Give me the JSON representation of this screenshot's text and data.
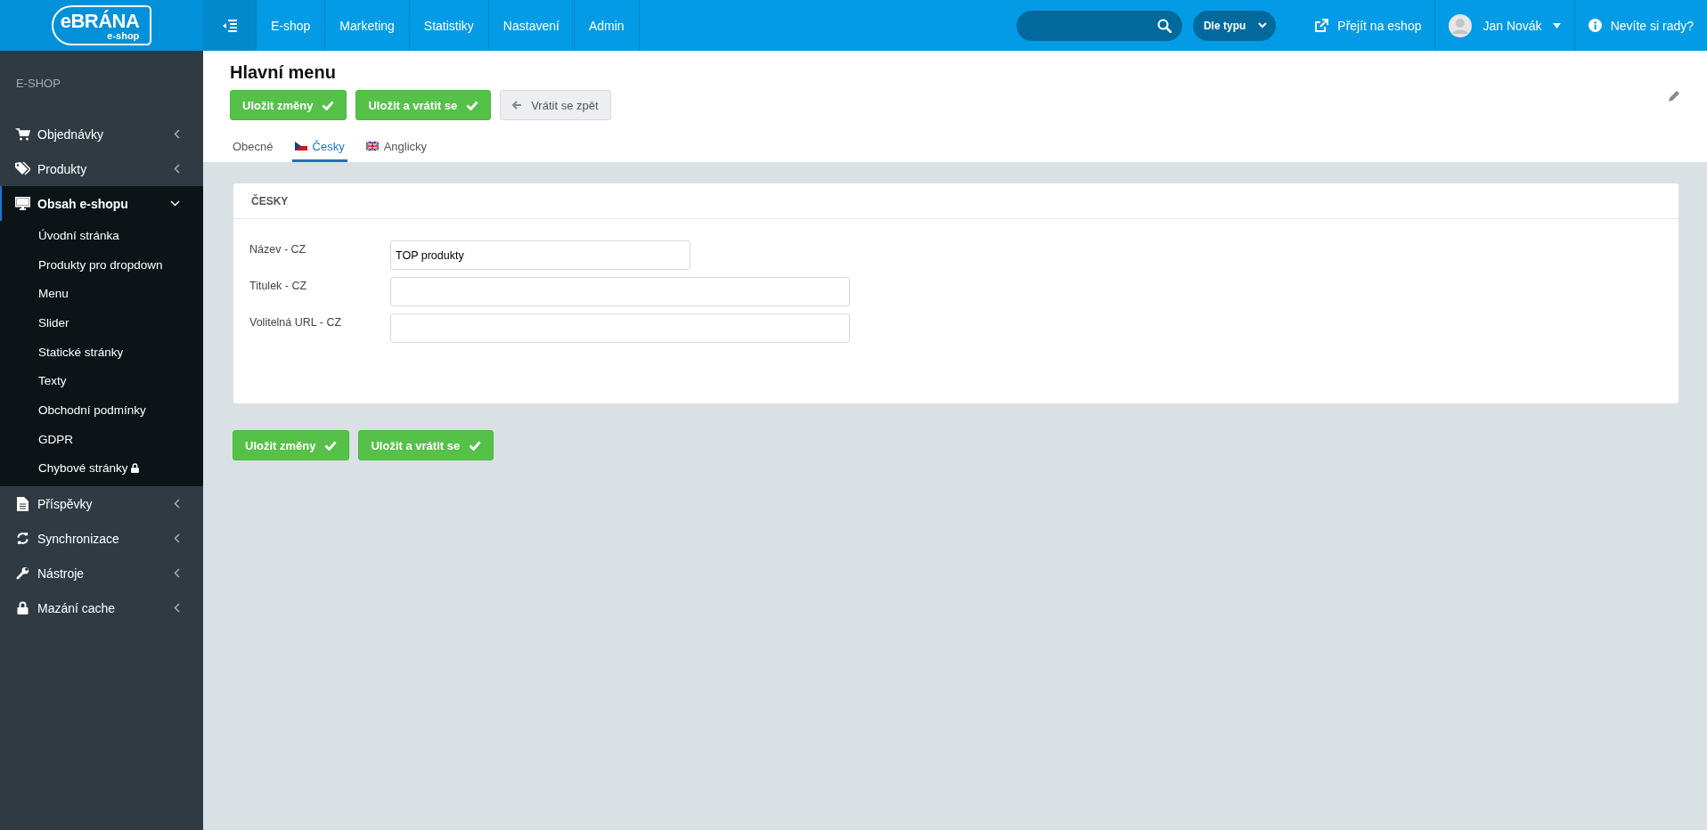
{
  "logo": {
    "name": "eBRÁNA",
    "sub": "e-shop"
  },
  "top_nav": [
    {
      "label": "E-shop"
    },
    {
      "label": "Marketing"
    },
    {
      "label": "Statistiky"
    },
    {
      "label": "Nastavení"
    },
    {
      "label": "Admin"
    }
  ],
  "search": {
    "filter": "Dle typu"
  },
  "eshop_link": "Přejít na eshop",
  "user": "Jan Novák",
  "help": "Nevíte si rady?",
  "sidebar": {
    "heading": "E-SHOP",
    "items": [
      {
        "label": "Objednávky",
        "expanded": false,
        "selected": false
      },
      {
        "label": "Produkty",
        "expanded": false,
        "selected": false
      },
      {
        "label": "Obsah e-shopu",
        "expanded": true,
        "selected": true,
        "children": [
          {
            "label": "Úvodní stránka",
            "locked": false
          },
          {
            "label": "Produkty pro dropdown",
            "locked": false
          },
          {
            "label": "Menu",
            "locked": false
          },
          {
            "label": "Slider",
            "locked": false
          },
          {
            "label": "Statické stránky",
            "locked": false
          },
          {
            "label": "Texty",
            "locked": false
          },
          {
            "label": "Obchodní podmínky",
            "locked": false
          },
          {
            "label": "GDPR",
            "locked": false
          },
          {
            "label": "Chybové stránky",
            "locked": true
          }
        ]
      },
      {
        "label": "Příspěvky",
        "expanded": false,
        "selected": false
      },
      {
        "label": "Synchronizace",
        "expanded": false,
        "selected": false
      },
      {
        "label": "Nástroje",
        "expanded": false,
        "selected": false
      },
      {
        "label": "Mazání cache",
        "expanded": false,
        "selected": false
      }
    ]
  },
  "page_title": "Hlavní menu",
  "top_buttons": [
    {
      "label": "Uložit změny",
      "kind": "primary"
    },
    {
      "label": "Uložit a vrátit se",
      "kind": "primary"
    },
    {
      "label": "Vrátit se zpět",
      "kind": "back"
    }
  ],
  "tabs": [
    {
      "label": "Obecné",
      "selected": false
    },
    {
      "label": "Česky",
      "selected": true
    },
    {
      "label": "Anglicky",
      "selected": false
    }
  ],
  "card": {
    "title": "ČESKY",
    "fields": [
      {
        "label": "Název - CZ",
        "value": "TOP produkty",
        "kind": "short"
      },
      {
        "label": "Titulek - CZ",
        "kind": "long"
      },
      {
        "label": "Volitelná URL - CZ",
        "kind": "long"
      }
    ]
  },
  "bottom_buttons": [
    {
      "label": "Uložit změny",
      "kind": "primary"
    },
    {
      "label": "Uložit a vrátit se",
      "kind": "primary"
    }
  ]
}
